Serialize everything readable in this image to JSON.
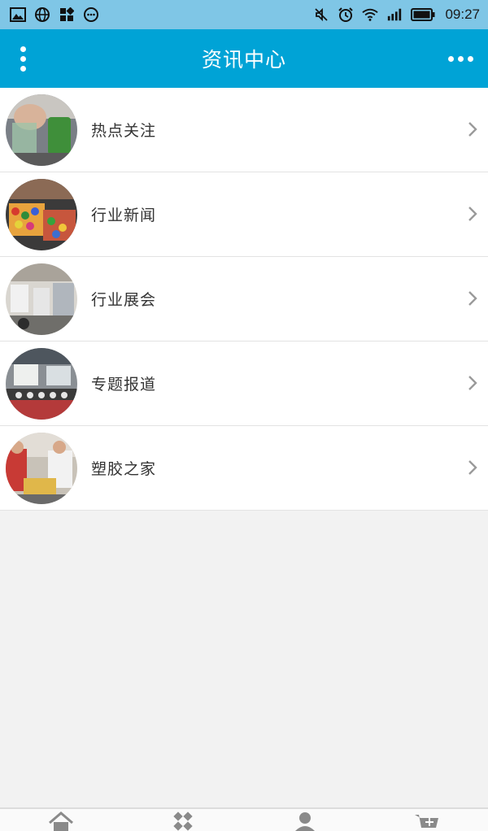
{
  "status_bar": {
    "left_icons": [
      "image-icon",
      "globe-icon",
      "apps-icon",
      "chat-icon"
    ],
    "right_icons": [
      "mute-icon",
      "alarm-icon",
      "wifi-icon",
      "signal-icon",
      "battery-icon"
    ],
    "time": "09:27"
  },
  "app_bar": {
    "title": "资讯中心",
    "left_icon": "vertical-dots-menu-icon",
    "right_icon": "horizontal-dots-more-icon"
  },
  "list": {
    "items": [
      {
        "label": "热点关注",
        "thumb": "hot-topics-photo"
      },
      {
        "label": "行业新闻",
        "thumb": "industry-news-photo"
      },
      {
        "label": "行业展会",
        "thumb": "industry-expo-photo"
      },
      {
        "label": "专题报道",
        "thumb": "special-report-photo"
      },
      {
        "label": "塑胶之家",
        "thumb": "plastics-home-photo"
      }
    ]
  },
  "bottom_nav": {
    "icons": [
      "home-icon",
      "categories-icon",
      "profile-icon",
      "cart-icon"
    ]
  },
  "colors": {
    "status_bar": "#7fc6e6",
    "app_bar": "#00a3d6",
    "background": "#f2f2f2",
    "divider": "#e3e3e3"
  }
}
